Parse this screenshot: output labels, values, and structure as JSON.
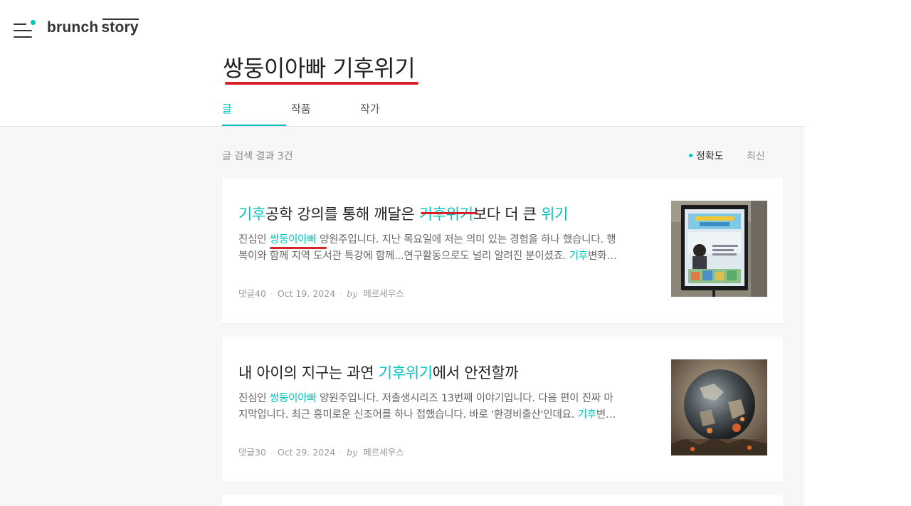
{
  "header": {
    "logo_part1": "brunch",
    "logo_part2": "story"
  },
  "search": {
    "query": "쌍둥이아빠 기후위기"
  },
  "tabs": [
    {
      "label": "글",
      "active": true
    },
    {
      "label": "작품",
      "active": false
    },
    {
      "label": "작가",
      "active": false
    }
  ],
  "results": {
    "count_text": "글 검색 결과 3건",
    "sort_accuracy": "정확도",
    "sort_latest": "최신"
  },
  "articles": [
    {
      "title_parts": [
        "기후",
        "공학 강의를 통해 깨달은 ",
        "기후위기",
        "보다 더 큰 ",
        "위기"
      ],
      "desc_line1_parts": [
        "진심인 ",
        "쌍둥이아빠",
        " 양원주입니다. 지난 목요일에 저는 의미 있는 경험을 하나 했습니다. 행"
      ],
      "desc_line2_parts": [
        "복이와 함께 지역 도서관 특강에 함께...연구활동으로도 널리 알려진 분이셨죠. ",
        "기후",
        "변화…"
      ],
      "comments": "댓글40",
      "date": "Oct 19. 2024",
      "by": "by",
      "author": "페르세우스",
      "thumb_icon": "climate-lecture-poster-image"
    },
    {
      "title_parts": [
        "내 아이의 지구는 과연 ",
        "기후위기",
        "에서 안전할까"
      ],
      "desc_line1_parts": [
        "진심인 ",
        "쌍둥이아빠",
        " 양원주입니다. 저출생시리즈 13번째 이야기입니다. 다음 편이 진짜 마"
      ],
      "desc_line2_parts": [
        "지막입니다. 최근 흥미로운 신조어를 하나 접했습니다. 바로 '환경비출산'인데요. ",
        "기후",
        "변…"
      ],
      "comments": "댓글30",
      "date": "Oct 29. 2024",
      "by": "by",
      "author": "페르세우스",
      "thumb_icon": "burning-earth-image"
    }
  ],
  "colors": {
    "accent": "#00c3bd",
    "annotation_red": "#d8222a"
  }
}
